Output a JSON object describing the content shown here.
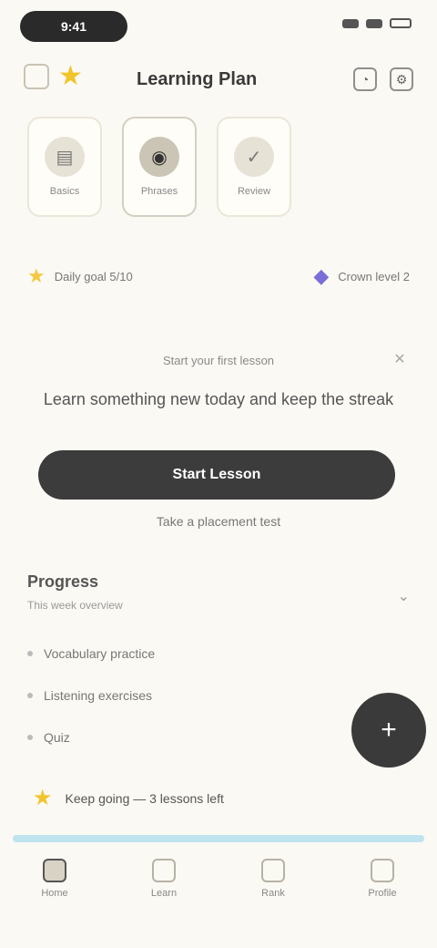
{
  "status": {
    "time": "9:41"
  },
  "header": {
    "title": "Learning Plan"
  },
  "cards": [
    {
      "label": "Basics",
      "icon": "book-icon"
    },
    {
      "label": "Phrases",
      "icon": "chat-icon"
    },
    {
      "label": "Review",
      "icon": "check-icon"
    }
  ],
  "stats": [
    {
      "text": "Daily goal 5/10",
      "icon": "star-icon",
      "color": "#f4c840"
    },
    {
      "text": "Crown level 2",
      "icon": "diamond-icon",
      "color": "#7a6ed8"
    }
  ],
  "prompt": {
    "subtitle": "Start your first lesson",
    "title": "Learn something new today and keep the streak"
  },
  "cta": {
    "label": "Start Lesson",
    "secondary": "Take a placement test"
  },
  "section": {
    "title": "Progress",
    "subtitle": "This week overview"
  },
  "list": [
    "Vocabulary practice",
    "Listening exercises",
    "Quiz"
  ],
  "highlight": {
    "text": "Keep going — 3 lessons left"
  },
  "nav": [
    {
      "label": "Home"
    },
    {
      "label": "Learn"
    },
    {
      "label": "Rank"
    },
    {
      "label": "Profile"
    }
  ],
  "colors": {
    "background": "#fbf9f3",
    "accent": "#3c3c3c",
    "highlight_bar": "#bfe3ef"
  }
}
